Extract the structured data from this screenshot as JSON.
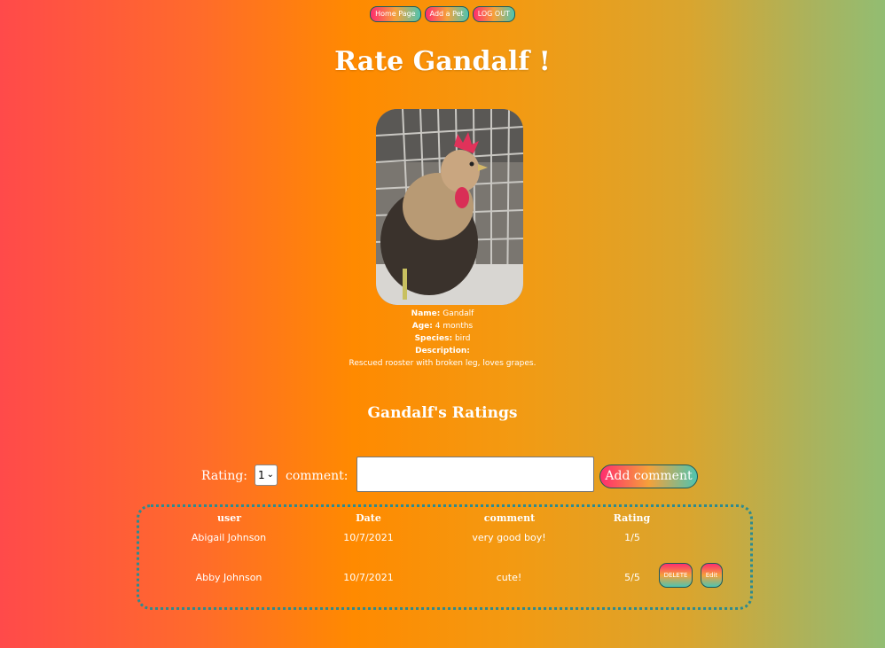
{
  "nav": {
    "home": "Home Page",
    "add_pet": "Add a Pet",
    "logout": "LOG OUT"
  },
  "title": "Rate Gandalf !",
  "pet": {
    "name_label": "Name:",
    "name": "Gandalf",
    "age_label": "Age:",
    "age": "4 months",
    "species_label": "Species:",
    "species": "bird",
    "description_label": "Description:",
    "description": "Rescued rooster with broken leg, loves grapes."
  },
  "ratings_heading": "Gandalf's Ratings",
  "form": {
    "rating_label": "Rating:",
    "rating_value": "1",
    "comment_label": "comment:",
    "add_button": "Add comment"
  },
  "table": {
    "headers": [
      "user",
      "Date",
      "comment",
      "Rating"
    ],
    "rows": [
      {
        "user": "Abigail Johnson",
        "date": "10/7/2021",
        "comment": "very good boy!",
        "rating": "1/5"
      },
      {
        "user": "Abby Johnson",
        "date": "10/7/2021",
        "comment": "cute!",
        "rating": "5/5",
        "delete": "DELETE",
        "edit": "Edit"
      }
    ]
  }
}
